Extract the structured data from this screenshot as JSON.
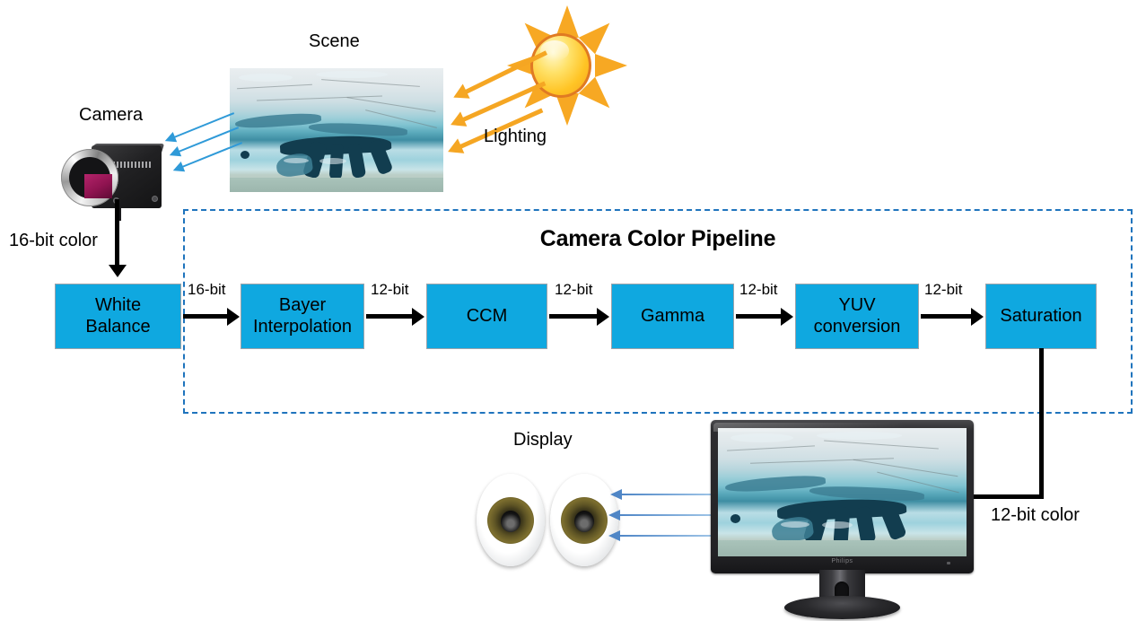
{
  "diagram": {
    "title": "Camera Color Pipeline",
    "labels": {
      "scene": "Scene",
      "camera": "Camera",
      "lighting": "Lighting",
      "display": "Display",
      "camera_output": "16-bit color",
      "display_input": "12-bit color"
    },
    "stages": [
      {
        "id": "white-balance",
        "label": "White\nBalance",
        "fill": "#0FA8E0",
        "in_bits": "16-bit color",
        "out_bits": "16-bit"
      },
      {
        "id": "bayer-interpolation",
        "label": "Bayer\nInterpolation",
        "fill": "#0FA8E0",
        "in_bits": "16-bit",
        "out_bits": "12-bit"
      },
      {
        "id": "ccm",
        "label": "CCM",
        "fill": "#0FA8E0",
        "in_bits": "12-bit",
        "out_bits": "12-bit"
      },
      {
        "id": "gamma",
        "label": "Gamma",
        "fill": "#0FA8E0",
        "in_bits": "12-bit",
        "out_bits": "12-bit"
      },
      {
        "id": "yuv-conversion",
        "label": "YUV\nconversion",
        "fill": "#0FA8E0",
        "in_bits": "12-bit",
        "out_bits": "12-bit"
      },
      {
        "id": "saturation",
        "label": "Saturation",
        "fill": "#0FA8E0",
        "in_bits": "12-bit",
        "out_bits": "12-bit color"
      }
    ],
    "connector_labels": [
      "16-bit",
      "12-bit",
      "12-bit",
      "12-bit",
      "12-bit"
    ],
    "monitor_brand": "Philips",
    "colors": {
      "stage_fill": "#0FA8E0",
      "pipeline_border": "#1F74BD",
      "arrow_black": "#000000",
      "light_arrow": "#F5A623",
      "scene_arrow": "#2F9AD8",
      "display_arrow": "#4F86C6",
      "background": "#FFFFFF"
    },
    "icons": {
      "sun": "sun-icon",
      "camera": "camera-icon",
      "eyes": "eyes-icon",
      "monitor": "monitor-icon",
      "scene": "glacier-photo"
    }
  }
}
